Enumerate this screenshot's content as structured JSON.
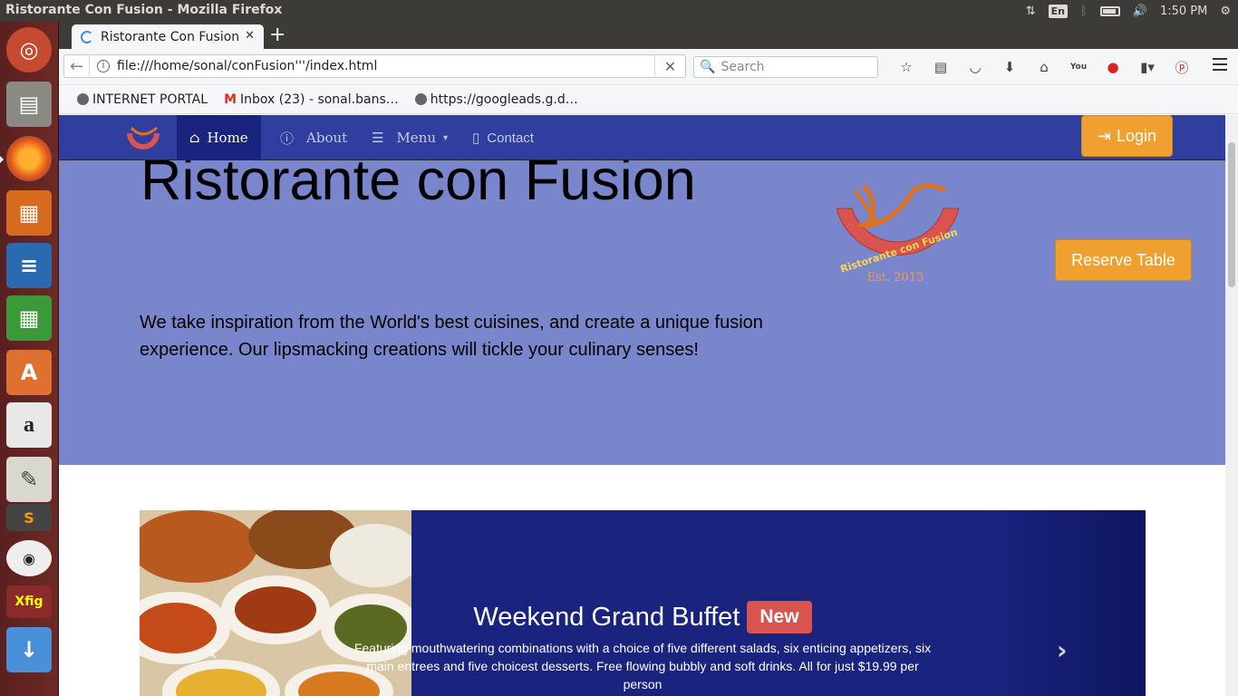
{
  "os": {
    "window_title": "Ristorante Con Fusion - Mozilla Firefox",
    "lang": "En",
    "time": "1:50 PM"
  },
  "browser": {
    "tab_title": "Ristorante Con Fusion",
    "url": "file:///home/sonal/conFusion'''/index.html",
    "search_placeholder": "Search",
    "bookmarks": [
      "INTERNET PORTAL",
      "Inbox (23) - sonal.bans…",
      "https://googleads.g.d…"
    ]
  },
  "site": {
    "nav": {
      "home": "Home",
      "about": "About",
      "menu": "Menu",
      "contact": "Contact",
      "login": "Login"
    },
    "heading": "Ristorante con Fusion",
    "lead": "We take inspiration from the World's best cuisines, and create a unique fusion experience. Our lipsmacking creations will tickle your culinary senses!",
    "logo_text": "Ristorante con Fusion",
    "logo_est": "Est. 2013",
    "reserve": "Reserve Table",
    "carousel": {
      "title": "Weekend Grand Buffet",
      "badge": "New",
      "text": "Featuring mouthwatering combinations with a choice of five different salads, six enticing appetizers, six main entrees and five choicest desserts. Free flowing bubbly and soft drinks. All for just $19.99 per person"
    }
  },
  "colors": {
    "jumbotron": "#7986cb",
    "navbar": "#303f9f",
    "accent": "#f0a030",
    "carousel": "#1a237e",
    "badge": "#d9534f"
  }
}
